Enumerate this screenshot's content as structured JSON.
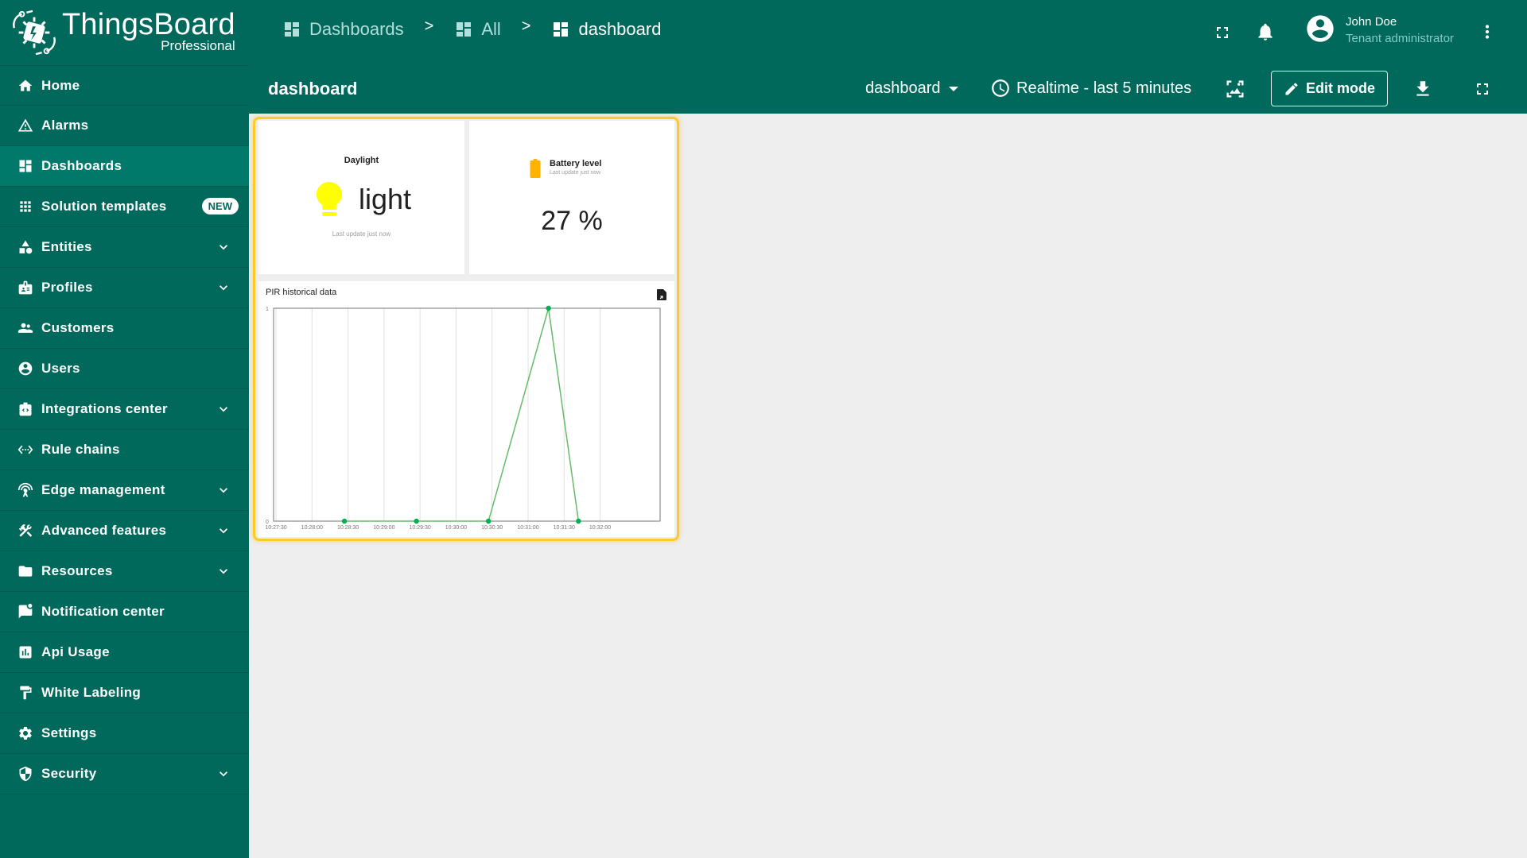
{
  "app": {
    "logo_title": "ThingsBoard",
    "logo_subtitle": "Professional"
  },
  "sidebar": {
    "items": [
      {
        "label": "Home",
        "icon": "home-icon",
        "expandable": false,
        "active": false
      },
      {
        "label": "Alarms",
        "icon": "warning-icon",
        "expandable": false,
        "active": false
      },
      {
        "label": "Dashboards",
        "icon": "dashboard-icon",
        "expandable": false,
        "active": true
      },
      {
        "label": "Solution templates",
        "icon": "apps-grid-icon",
        "expandable": false,
        "active": false,
        "badge": "NEW"
      },
      {
        "label": "Entities",
        "icon": "category-icon",
        "expandable": true,
        "active": false
      },
      {
        "label": "Profiles",
        "icon": "badge-icon",
        "expandable": true,
        "active": false
      },
      {
        "label": "Customers",
        "icon": "people-icon",
        "expandable": false,
        "active": false
      },
      {
        "label": "Users",
        "icon": "account-circle-icon",
        "expandable": false,
        "active": false
      },
      {
        "label": "Integrations center",
        "icon": "integration-icon",
        "expandable": true,
        "active": false
      },
      {
        "label": "Rule chains",
        "icon": "settings-ethernet-icon",
        "expandable": false,
        "active": false
      },
      {
        "label": "Edge management",
        "icon": "router-icon",
        "expandable": true,
        "active": false
      },
      {
        "label": "Advanced features",
        "icon": "construction-icon",
        "expandable": true,
        "active": false
      },
      {
        "label": "Resources",
        "icon": "folder-icon",
        "expandable": true,
        "active": false
      },
      {
        "label": "Notification center",
        "icon": "mark-chat-unread-icon",
        "expandable": false,
        "active": false
      },
      {
        "label": "Api Usage",
        "icon": "insert-chart-icon",
        "expandable": false,
        "active": false
      },
      {
        "label": "White Labeling",
        "icon": "format-paint-icon",
        "expandable": false,
        "active": false
      },
      {
        "label": "Settings",
        "icon": "gear-icon",
        "expandable": false,
        "active": false
      },
      {
        "label": "Security",
        "icon": "security-icon",
        "expandable": true,
        "active": false
      }
    ]
  },
  "header": {
    "breadcrumb": [
      {
        "label": "Dashboards",
        "icon": "dashboard-icon"
      },
      {
        "label": "All",
        "icon": "dashboard-icon"
      },
      {
        "label": "dashboard",
        "icon": "dashboard-icon"
      }
    ],
    "separator": ">",
    "user": {
      "name": "John Doe",
      "role": "Tenant administrator"
    }
  },
  "toolbar": {
    "dashboard_title": "dashboard",
    "state_select": "dashboard",
    "timewindow": "Realtime - last 5 minutes",
    "edit_label": "Edit mode"
  },
  "widgets": {
    "daylight": {
      "title": "Daylight",
      "value": "light",
      "last_update": "Last update just now",
      "icon": "lightbulb-icon",
      "icon_color": "#ffff00"
    },
    "battery": {
      "title": "Battery level",
      "last_update": "Last update just now",
      "value": "27 %",
      "value_numeric": 27,
      "icon": "battery-icon",
      "icon_color": "#ffb300"
    }
  },
  "colors": {
    "primary": "#00695c",
    "active_nav": "#00796b",
    "highlight_border": "#ffca28",
    "series_line": "#66bb6a",
    "series_point": "#00b050"
  },
  "chart_data": {
    "type": "line",
    "title": "PIR historical data",
    "xlabel": "",
    "ylabel": "",
    "ylim": [
      0,
      1
    ],
    "yticks": [
      "0",
      "1"
    ],
    "xticks": [
      "10:27:30",
      "10:28:00",
      "10:28:30",
      "10:29:00",
      "10:29:30",
      "10:30:00",
      "10:30:30",
      "10:31:00",
      "10:31:30",
      "10:32:00"
    ],
    "xlim": [
      "10:27:28",
      "10:32:50"
    ],
    "grid": true,
    "legend": "none",
    "series": [
      {
        "name": "PIR",
        "x": [
          "10:28:27",
          "10:29:27",
          "10:30:27",
          "10:31:17",
          "10:31:42"
        ],
        "values": [
          0,
          0,
          0,
          1,
          0
        ]
      }
    ]
  }
}
